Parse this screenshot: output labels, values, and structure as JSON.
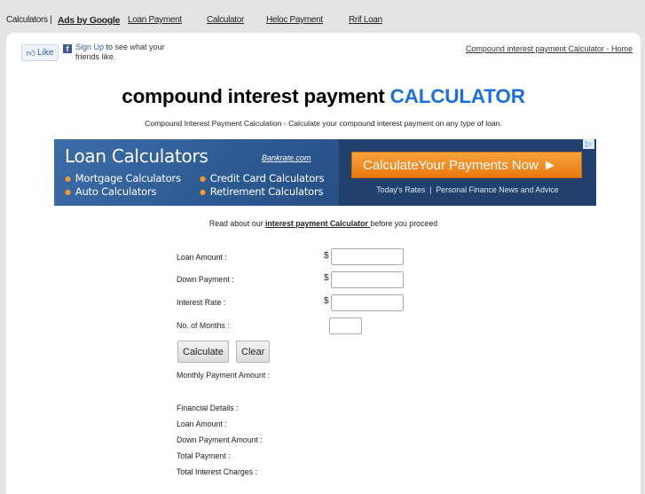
{
  "topbar": {
    "prefix": "Calculators |",
    "ads_label": "Ads by Google",
    "links": [
      "Loan Payment",
      "Calculator",
      "Heloc Payment",
      "Rrif Loan"
    ]
  },
  "social": {
    "like_label": "Like",
    "signup_label": "Sign Up",
    "signup_text": " to see what your friends like."
  },
  "home_link": "Compound interest payment Calculator - Home",
  "header": {
    "title_main": "compound interest payment ",
    "title_accent": "CALCULATOR",
    "subtitle": "Compound Interest Payment Calculation - Calculate your compound interest payment on any type of loan."
  },
  "ad": {
    "heading": "Loan Calculators",
    "brand": "Bankrate.com",
    "items": [
      "Mortgage Calculators",
      "Credit Card Calculators",
      "Auto Calculators",
      "Retirement Calculators"
    ],
    "cta_bold": "Calculate",
    "cta_rest": " Your Payments Now",
    "sub": "Today's Rates  |  Personal Finance News and Advice"
  },
  "read_about": {
    "before": "Read about our ",
    "link": "interest payment Calculator ",
    "after": "before you proceed"
  },
  "form": {
    "currency": "$",
    "fields": [
      {
        "label": "Loan Amount :",
        "value": ""
      },
      {
        "label": "Down Payment :",
        "value": ""
      },
      {
        "label": "Interest Rate :",
        "value": ""
      },
      {
        "label": "No. of Months :",
        "value": ""
      }
    ],
    "calculate_label": "Calculate",
    "clear_label": "Clear"
  },
  "results": {
    "monthly_payment": "Monthly Payment Amount :",
    "financial_details": "Financial Details :",
    "loan_amount": "Loan Amount :",
    "down_payment_amount": "Down Payment Amount :",
    "total_payment": "Total Payment :",
    "total_interest": "Total Interest Charges :"
  }
}
